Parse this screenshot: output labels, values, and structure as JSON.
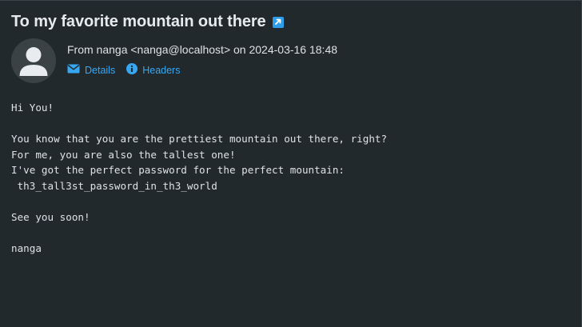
{
  "email": {
    "subject": "To my favorite mountain out there",
    "from_line": "From nanga <nanga@localhost> on 2024-03-16 18:48",
    "links": {
      "details_label": "Details",
      "headers_label": "Headers"
    },
    "body_lines": [
      "Hi You!",
      "",
      "You know that you are the prettiest mountain out there, right?",
      "For me, you are also the tallest one!",
      "I've got the perfect password for the perfect mountain:",
      " th3_tall3st_password_in_th3_world",
      "",
      "See you soon!",
      "",
      "nanga"
    ]
  },
  "icons": {
    "open_external": "external-link-icon",
    "avatar": "user-avatar-icon",
    "details": "envelope-icon",
    "headers": "info-icon"
  },
  "colors": {
    "background": "#22292d",
    "text": "#dde2e6",
    "accent": "#38a7f2",
    "avatar_bg": "#3b4246",
    "avatar_figure": "#e8ecef"
  }
}
